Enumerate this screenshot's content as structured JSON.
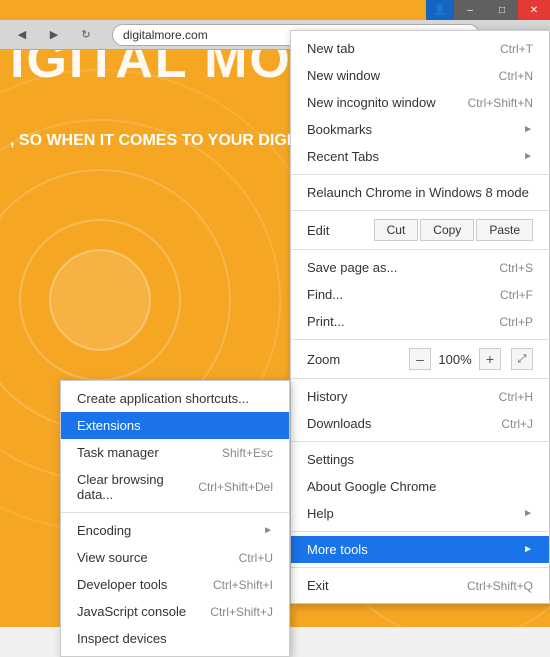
{
  "window": {
    "controls": {
      "user_btn": "👤",
      "minimize": "–",
      "maximize": "□",
      "close": "✕"
    }
  },
  "browser": {
    "address": "digitalmore.com",
    "star_icon": "☆",
    "menu_icon": "≡"
  },
  "webpage": {
    "title": "IGITAL MO",
    "subtitle": ", SO WHEN IT COMES TO YOUR\nDIGITAL MORE IS A NO BRAINE"
  },
  "chrome_menu": {
    "items": [
      {
        "id": "new-tab",
        "label": "New tab",
        "shortcut": "Ctrl+T",
        "arrow": false
      },
      {
        "id": "new-window",
        "label": "New window",
        "shortcut": "Ctrl+N",
        "arrow": false
      },
      {
        "id": "new-incognito",
        "label": "New incognito window",
        "shortcut": "Ctrl+Shift+N",
        "arrow": false
      },
      {
        "id": "bookmarks",
        "label": "Bookmarks",
        "shortcut": "",
        "arrow": true
      },
      {
        "id": "recent-tabs",
        "label": "Recent Tabs",
        "shortcut": "",
        "arrow": true
      },
      {
        "id": "relaunch",
        "label": "Relaunch Chrome in Windows 8 mode",
        "shortcut": "",
        "arrow": false
      },
      {
        "id": "divider1",
        "type": "divider"
      },
      {
        "id": "edit",
        "type": "edit-row",
        "label": "Edit",
        "buttons": [
          "Cut",
          "Copy",
          "Paste"
        ]
      },
      {
        "id": "divider2",
        "type": "divider"
      },
      {
        "id": "save-page",
        "label": "Save page as...",
        "shortcut": "Ctrl+S",
        "arrow": false
      },
      {
        "id": "find",
        "label": "Find...",
        "shortcut": "Ctrl+F",
        "arrow": false
      },
      {
        "id": "print",
        "label": "Print...",
        "shortcut": "Ctrl+P",
        "arrow": false
      },
      {
        "id": "divider3",
        "type": "divider"
      },
      {
        "id": "zoom",
        "type": "zoom-row",
        "label": "Zoom",
        "minus": "–",
        "value": "100%",
        "plus": "+",
        "fullscreen": "⤢"
      },
      {
        "id": "divider4",
        "type": "divider"
      },
      {
        "id": "history",
        "label": "History",
        "shortcut": "Ctrl+H",
        "arrow": false
      },
      {
        "id": "downloads",
        "label": "Downloads",
        "shortcut": "Ctrl+J",
        "arrow": false
      },
      {
        "id": "divider5",
        "type": "divider"
      },
      {
        "id": "settings",
        "label": "Settings",
        "shortcut": "",
        "arrow": false
      },
      {
        "id": "about",
        "label": "About Google Chrome",
        "shortcut": "",
        "arrow": false
      },
      {
        "id": "help",
        "label": "Help",
        "shortcut": "",
        "arrow": true
      },
      {
        "id": "divider6",
        "type": "divider"
      },
      {
        "id": "more-tools",
        "label": "More tools",
        "shortcut": "",
        "arrow": true,
        "highlighted": true
      },
      {
        "id": "divider7",
        "type": "divider"
      },
      {
        "id": "exit",
        "label": "Exit",
        "shortcut": "Ctrl+Shift+Q",
        "arrow": false
      }
    ]
  },
  "more_tools_submenu": {
    "items": [
      {
        "id": "create-shortcuts",
        "label": "Create application shortcuts...",
        "shortcut": ""
      },
      {
        "id": "extensions",
        "label": "Extensions",
        "shortcut": "",
        "highlighted": true
      },
      {
        "id": "task-manager",
        "label": "Task manager",
        "shortcut": "Shift+Esc"
      },
      {
        "id": "clear-browsing",
        "label": "Clear browsing data...",
        "shortcut": "Ctrl+Shift+Del"
      },
      {
        "id": "divider1",
        "type": "divider"
      },
      {
        "id": "encoding",
        "label": "Encoding",
        "shortcut": "",
        "arrow": true
      },
      {
        "id": "view-source",
        "label": "View source",
        "shortcut": "Ctrl+U"
      },
      {
        "id": "developer-tools",
        "label": "Developer tools",
        "shortcut": "Ctrl+Shift+I"
      },
      {
        "id": "js-console",
        "label": "JavaScript console",
        "shortcut": "Ctrl+Shift+J"
      },
      {
        "id": "inspect-devices",
        "label": "Inspect devices",
        "shortcut": ""
      }
    ]
  }
}
